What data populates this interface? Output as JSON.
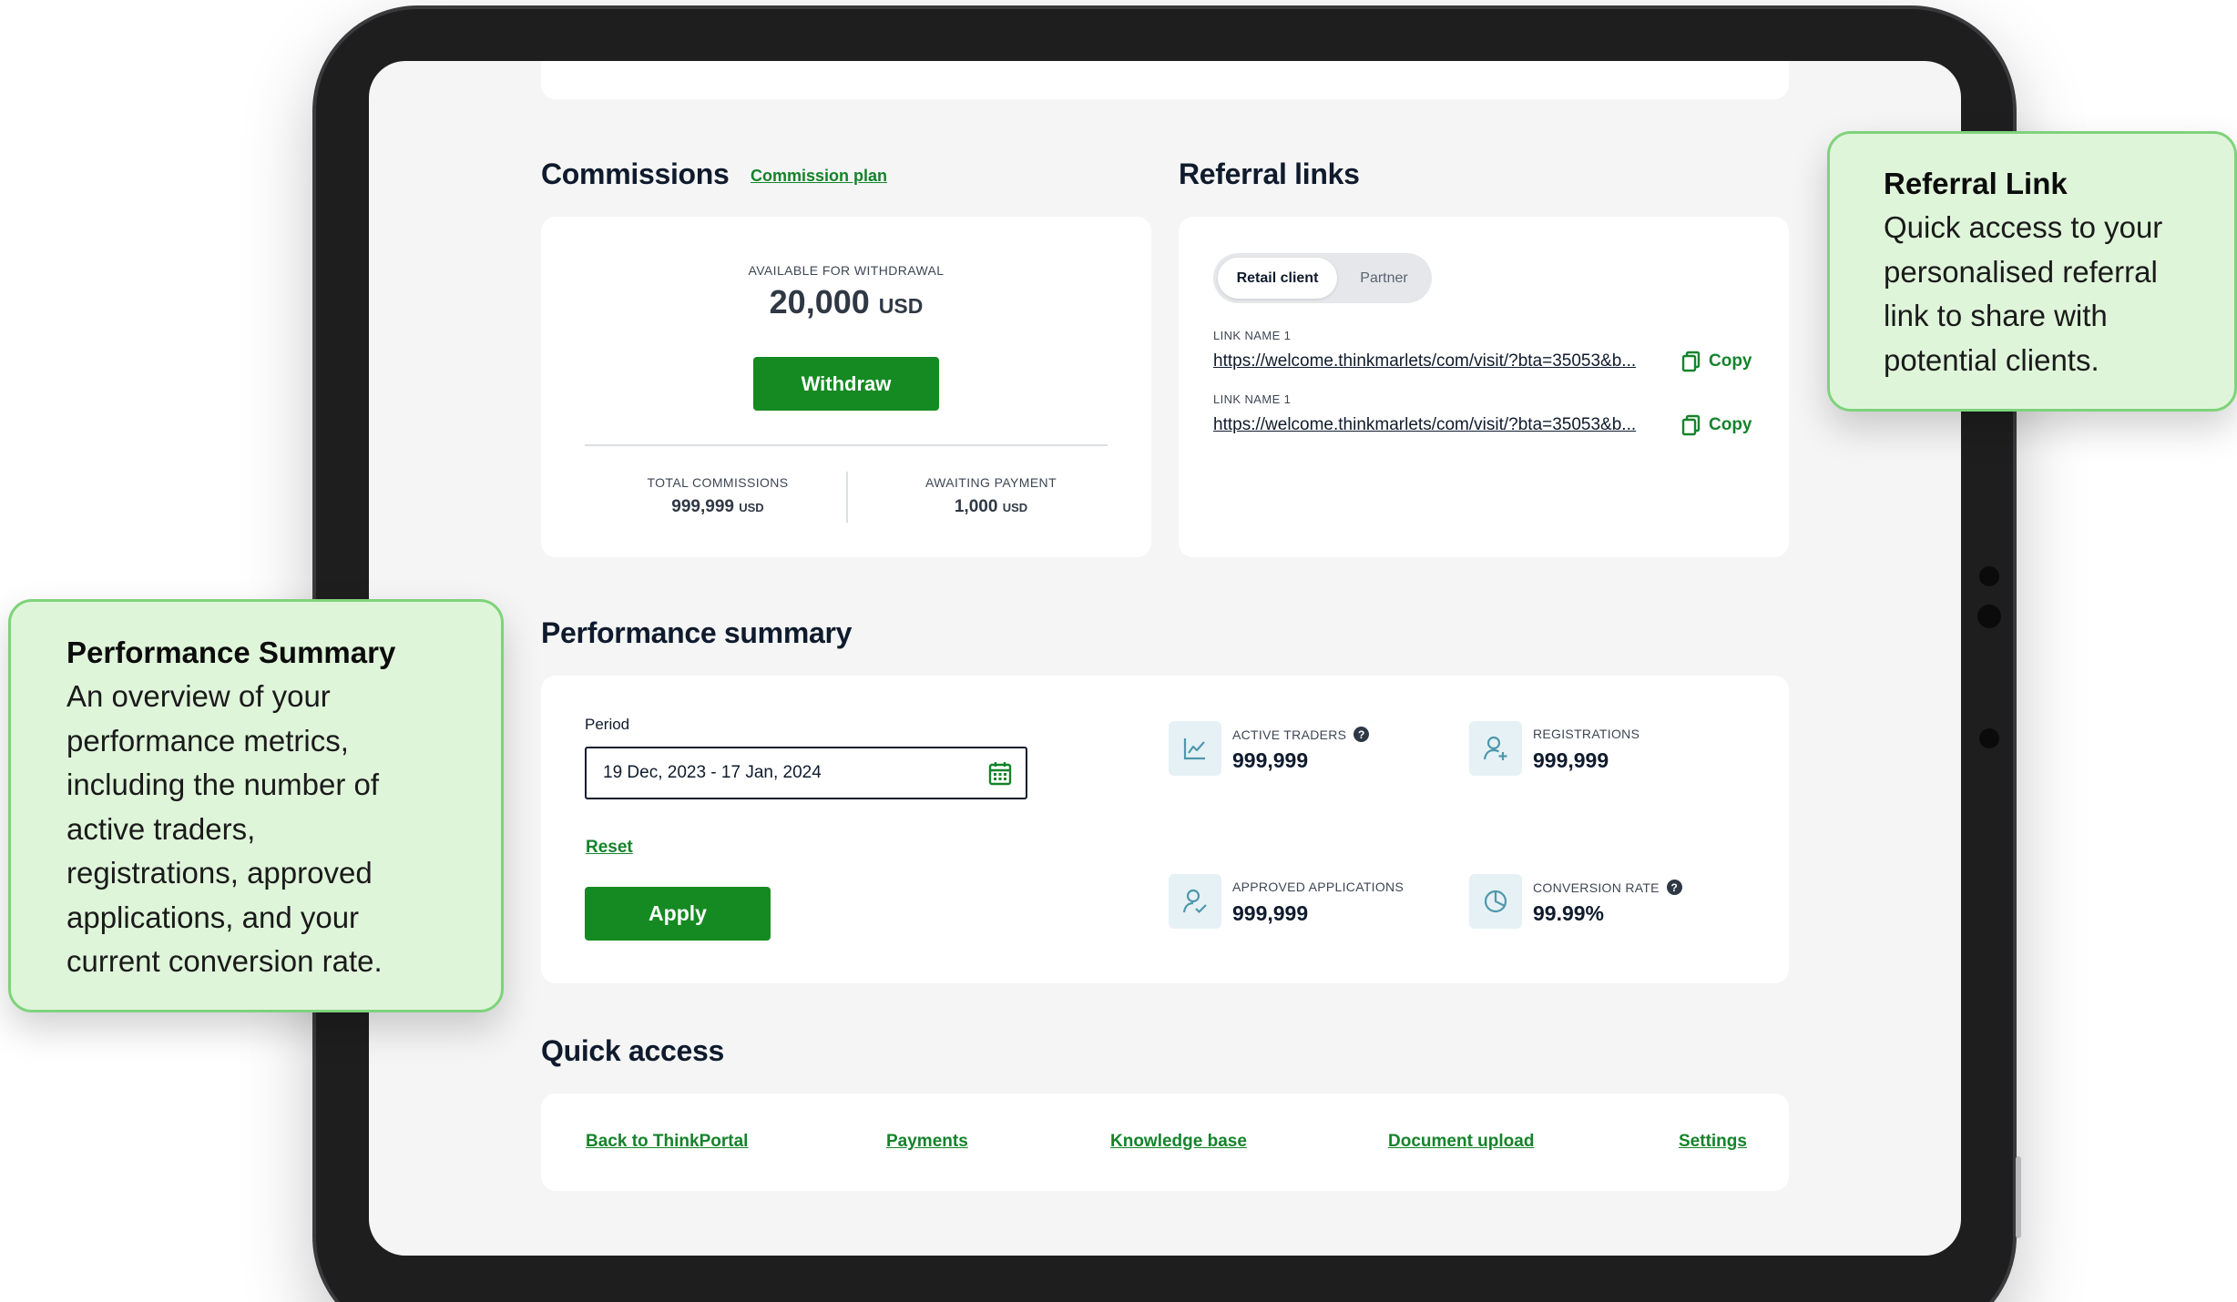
{
  "commissions": {
    "title": "Commissions",
    "plan_link": "Commission plan",
    "available_label": "AVAILABLE FOR WITHDRAWAL",
    "available_value": "20,000",
    "available_currency": "USD",
    "withdraw_label": "Withdraw",
    "total_label": "TOTAL COMMISSIONS",
    "total_value": "999,999",
    "total_currency": "USD",
    "awaiting_label": "AWAITING PAYMENT",
    "awaiting_value": "1,000",
    "awaiting_currency": "USD"
  },
  "referral": {
    "title": "Referral links",
    "tabs": [
      "Retail client",
      "Partner"
    ],
    "active_tab": "Retail client",
    "links": [
      {
        "label": "LINK NAME 1",
        "url": "https://welcome.thinkmarlets/com/visit/?bta=35053&b...",
        "copy_label": "Copy"
      },
      {
        "label": "LINK NAME 1",
        "url": "https://welcome.thinkmarlets/com/visit/?bta=35053&b...",
        "copy_label": "Copy"
      }
    ]
  },
  "performance": {
    "title": "Performance summary",
    "period_label": "Period",
    "period_value": "19 Dec, 2023 - 17 Jan, 2024",
    "reset_label": "Reset",
    "apply_label": "Apply",
    "metrics": [
      {
        "label": "ACTIVE TRADERS",
        "value": "999,999",
        "icon": "line-chart-icon",
        "info": "?"
      },
      {
        "label": "REGISTRATIONS",
        "value": "999,999",
        "icon": "user-add-icon"
      },
      {
        "label": "APPROVED APPLICATIONS",
        "value": "999,999",
        "icon": "user-check-icon"
      },
      {
        "label": "CONVERSION RATE",
        "value": "99.99%",
        "icon": "pie-chart-icon",
        "info": "?"
      }
    ]
  },
  "quick_access": {
    "title": "Quick access",
    "links": [
      "Back to ThinkPortal",
      "Payments",
      "Knowledge base",
      "Document upload",
      "Settings"
    ]
  },
  "callouts": {
    "referral": {
      "title": "Referral Link",
      "lines": [
        "Quick access to your",
        "personalised referral",
        "link to share with",
        "potential clients."
      ]
    },
    "performance": {
      "title": "Performance Summary",
      "lines": [
        "An overview of your",
        "performance metrics,",
        "including the number of",
        "active traders,",
        "registrations, approved",
        "applications, and your",
        "current conversion rate."
      ]
    }
  },
  "colors": {
    "accent_green": "#158a22",
    "link_green": "#15832b",
    "callout_bg": "#dff5da",
    "callout_border": "#7ed37a",
    "icon_tile": "#e6f1f5"
  }
}
